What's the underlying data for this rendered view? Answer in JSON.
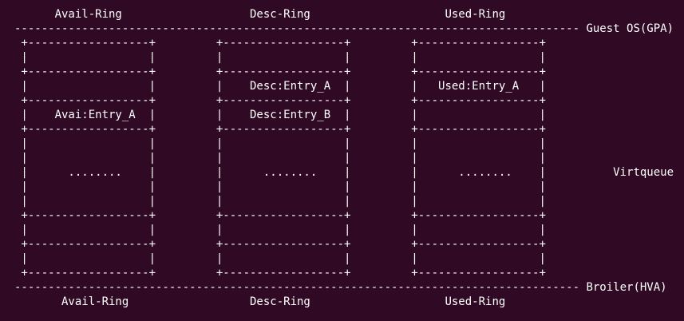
{
  "terminal": {
    "lines": [
      "      Avail-Ring                   Desc-Ring                    Used-Ring",
      "------------------------------------------------------------------------------------ Guest OS(GPA)",
      " +------------------+         +------------------+         +------------------+",
      " |                  |         |                  |         |                  |",
      " +------------------+         +------------------+         +------------------+",
      " |                  |         |    Desc:Entry_A  |         |   Used:Entry_A   |",
      " +------------------+         +------------------+         +------------------+",
      " |    Avai:Entry_A  |         |    Desc:Entry_B  |         |                  |",
      " +------------------+         +------------------+         +------------------+",
      " |                  |         |                  |         |                  |",
      " |                  |         |                  |         |                  |",
      " |      ........    |         |      ........    |         |      ........    |          Virtqueue",
      " |                  |         |                  |         |                  |",
      " |                  |         |                  |         |                  |",
      " +------------------+         +------------------+         +------------------+",
      " |                  |         |                  |         |                  |",
      " +------------------+         +------------------+         +------------------+",
      " |                  |         |                  |         |                  |",
      " +------------------+         +------------------+         +------------------+",
      "------------------------------------------------------------------------------------ Broiler(HVA)",
      "       Avail-Ring                  Desc-Ring                    Used-Ring"
    ]
  },
  "colors": {
    "background": "#300a24",
    "foreground": "#ffffff"
  }
}
